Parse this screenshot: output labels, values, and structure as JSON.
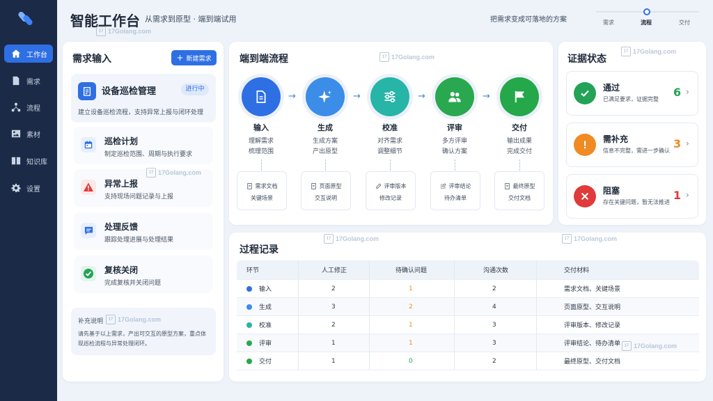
{
  "header": {
    "title": "智能工作台",
    "subtitle": "从需求到原型 · 端到端试用",
    "slogan": "把需求变成可落地的方案",
    "steps": [
      {
        "label": "需求"
      },
      {
        "label": "流程"
      },
      {
        "label": "交付"
      }
    ]
  },
  "sidebar": {
    "items": [
      {
        "label": "工作台",
        "icon": "home-icon"
      },
      {
        "label": "需求",
        "icon": "document-icon"
      },
      {
        "label": "流程",
        "icon": "flow-icon"
      },
      {
        "label": "素材",
        "icon": "image-icon"
      },
      {
        "label": "知识库",
        "icon": "book-icon"
      },
      {
        "label": "设置",
        "icon": "gear-icon"
      }
    ]
  },
  "left": {
    "title": "需求输入",
    "new_button": "新建需求",
    "project": {
      "name": "设备巡检管理",
      "badge": "进行中",
      "desc": "建立设备巡检流程，支持异常上报与闭环处理"
    },
    "tasks": [
      {
        "name": "巡检计划",
        "desc": "制定巡检范围、周期与执行要求",
        "icon": "calendar-icon",
        "color": "#2f6fe4"
      },
      {
        "name": "异常上报",
        "desc": "支持现场问题记录与上报",
        "icon": "warning-icon",
        "color": "#e03a3a"
      },
      {
        "name": "处理反馈",
        "desc": "跟踪处理进展与处理结果",
        "icon": "chat-icon",
        "color": "#2f6fe4"
      },
      {
        "name": "复核关闭",
        "desc": "完成复核并关闭问题",
        "icon": "check-icon",
        "color": "#22a355"
      }
    ],
    "note": {
      "title": "补充说明",
      "text": "请先基于以上需求，产出可交互的原型方案，重点体现巡检流程与异常处理闭环。"
    }
  },
  "flow": {
    "title": "端到端流程",
    "steps": [
      {
        "name": "输入",
        "desc1": "理解需求",
        "desc2": "梳理范围",
        "doc1": "需求文档",
        "doc2": "关键场景",
        "color": "#2f6fe4"
      },
      {
        "name": "生成",
        "desc1": "生成方案",
        "desc2": "产出原型",
        "doc1": "页面原型",
        "doc2": "交互说明",
        "color": "#3b8de8"
      },
      {
        "name": "校准",
        "desc1": "对齐需求",
        "desc2": "调整细节",
        "doc1": "评审版本",
        "doc2": "修改记录",
        "color": "#26b5a6"
      },
      {
        "name": "评审",
        "desc1": "多方评审",
        "desc2": "确认方案",
        "doc1": "评审结论",
        "doc2": "待办清单",
        "color": "#2aa84f"
      },
      {
        "name": "交付",
        "desc1": "输出成果",
        "desc2": "完成交付",
        "doc1": "最终原型",
        "doc2": "交付文档",
        "color": "#25a84a"
      }
    ]
  },
  "evidence": {
    "title": "证据状态",
    "items": [
      {
        "name": "通过",
        "desc": "已满足要求，证据完整",
        "count": "6",
        "color": "#22a355",
        "icon": "check-icon"
      },
      {
        "name": "需补充",
        "desc": "信息不完整，需进一步确认",
        "count": "3",
        "color": "#f08a24",
        "icon": "exclamation-icon"
      },
      {
        "name": "阻塞",
        "desc": "存在关键问题，暂无法推进",
        "count": "1",
        "color": "#e03a3a",
        "icon": "close-icon"
      }
    ]
  },
  "records": {
    "title": "过程记录",
    "headers": [
      "环节",
      "人工修正",
      "待确认问题",
      "沟通次数",
      "交付材料"
    ],
    "rows": [
      {
        "stage": "输入",
        "fix": "2",
        "pending": "1",
        "comm": "2",
        "material": "需求文档、关键场景",
        "dot": "#2f6fe4",
        "pcolor": "#f08a24"
      },
      {
        "stage": "生成",
        "fix": "3",
        "pending": "2",
        "comm": "4",
        "material": "页面原型、交互说明",
        "dot": "#3b8de8",
        "pcolor": "#f08a24"
      },
      {
        "stage": "校准",
        "fix": "2",
        "pending": "1",
        "comm": "3",
        "material": "评审版本、修改记录",
        "dot": "#26b5a6",
        "pcolor": "#f08a24"
      },
      {
        "stage": "评审",
        "fix": "1",
        "pending": "1",
        "comm": "3",
        "material": "评审结论、待办清单",
        "dot": "#2aa84f",
        "pcolor": "#f08a24"
      },
      {
        "stage": "交付",
        "fix": "1",
        "pending": "0",
        "comm": "2",
        "material": "最终原型、交付文档",
        "dot": "#25a84a",
        "pcolor": "#22a355"
      }
    ]
  },
  "watermark": "17Golang.com",
  "accent": "#2f6fe4"
}
